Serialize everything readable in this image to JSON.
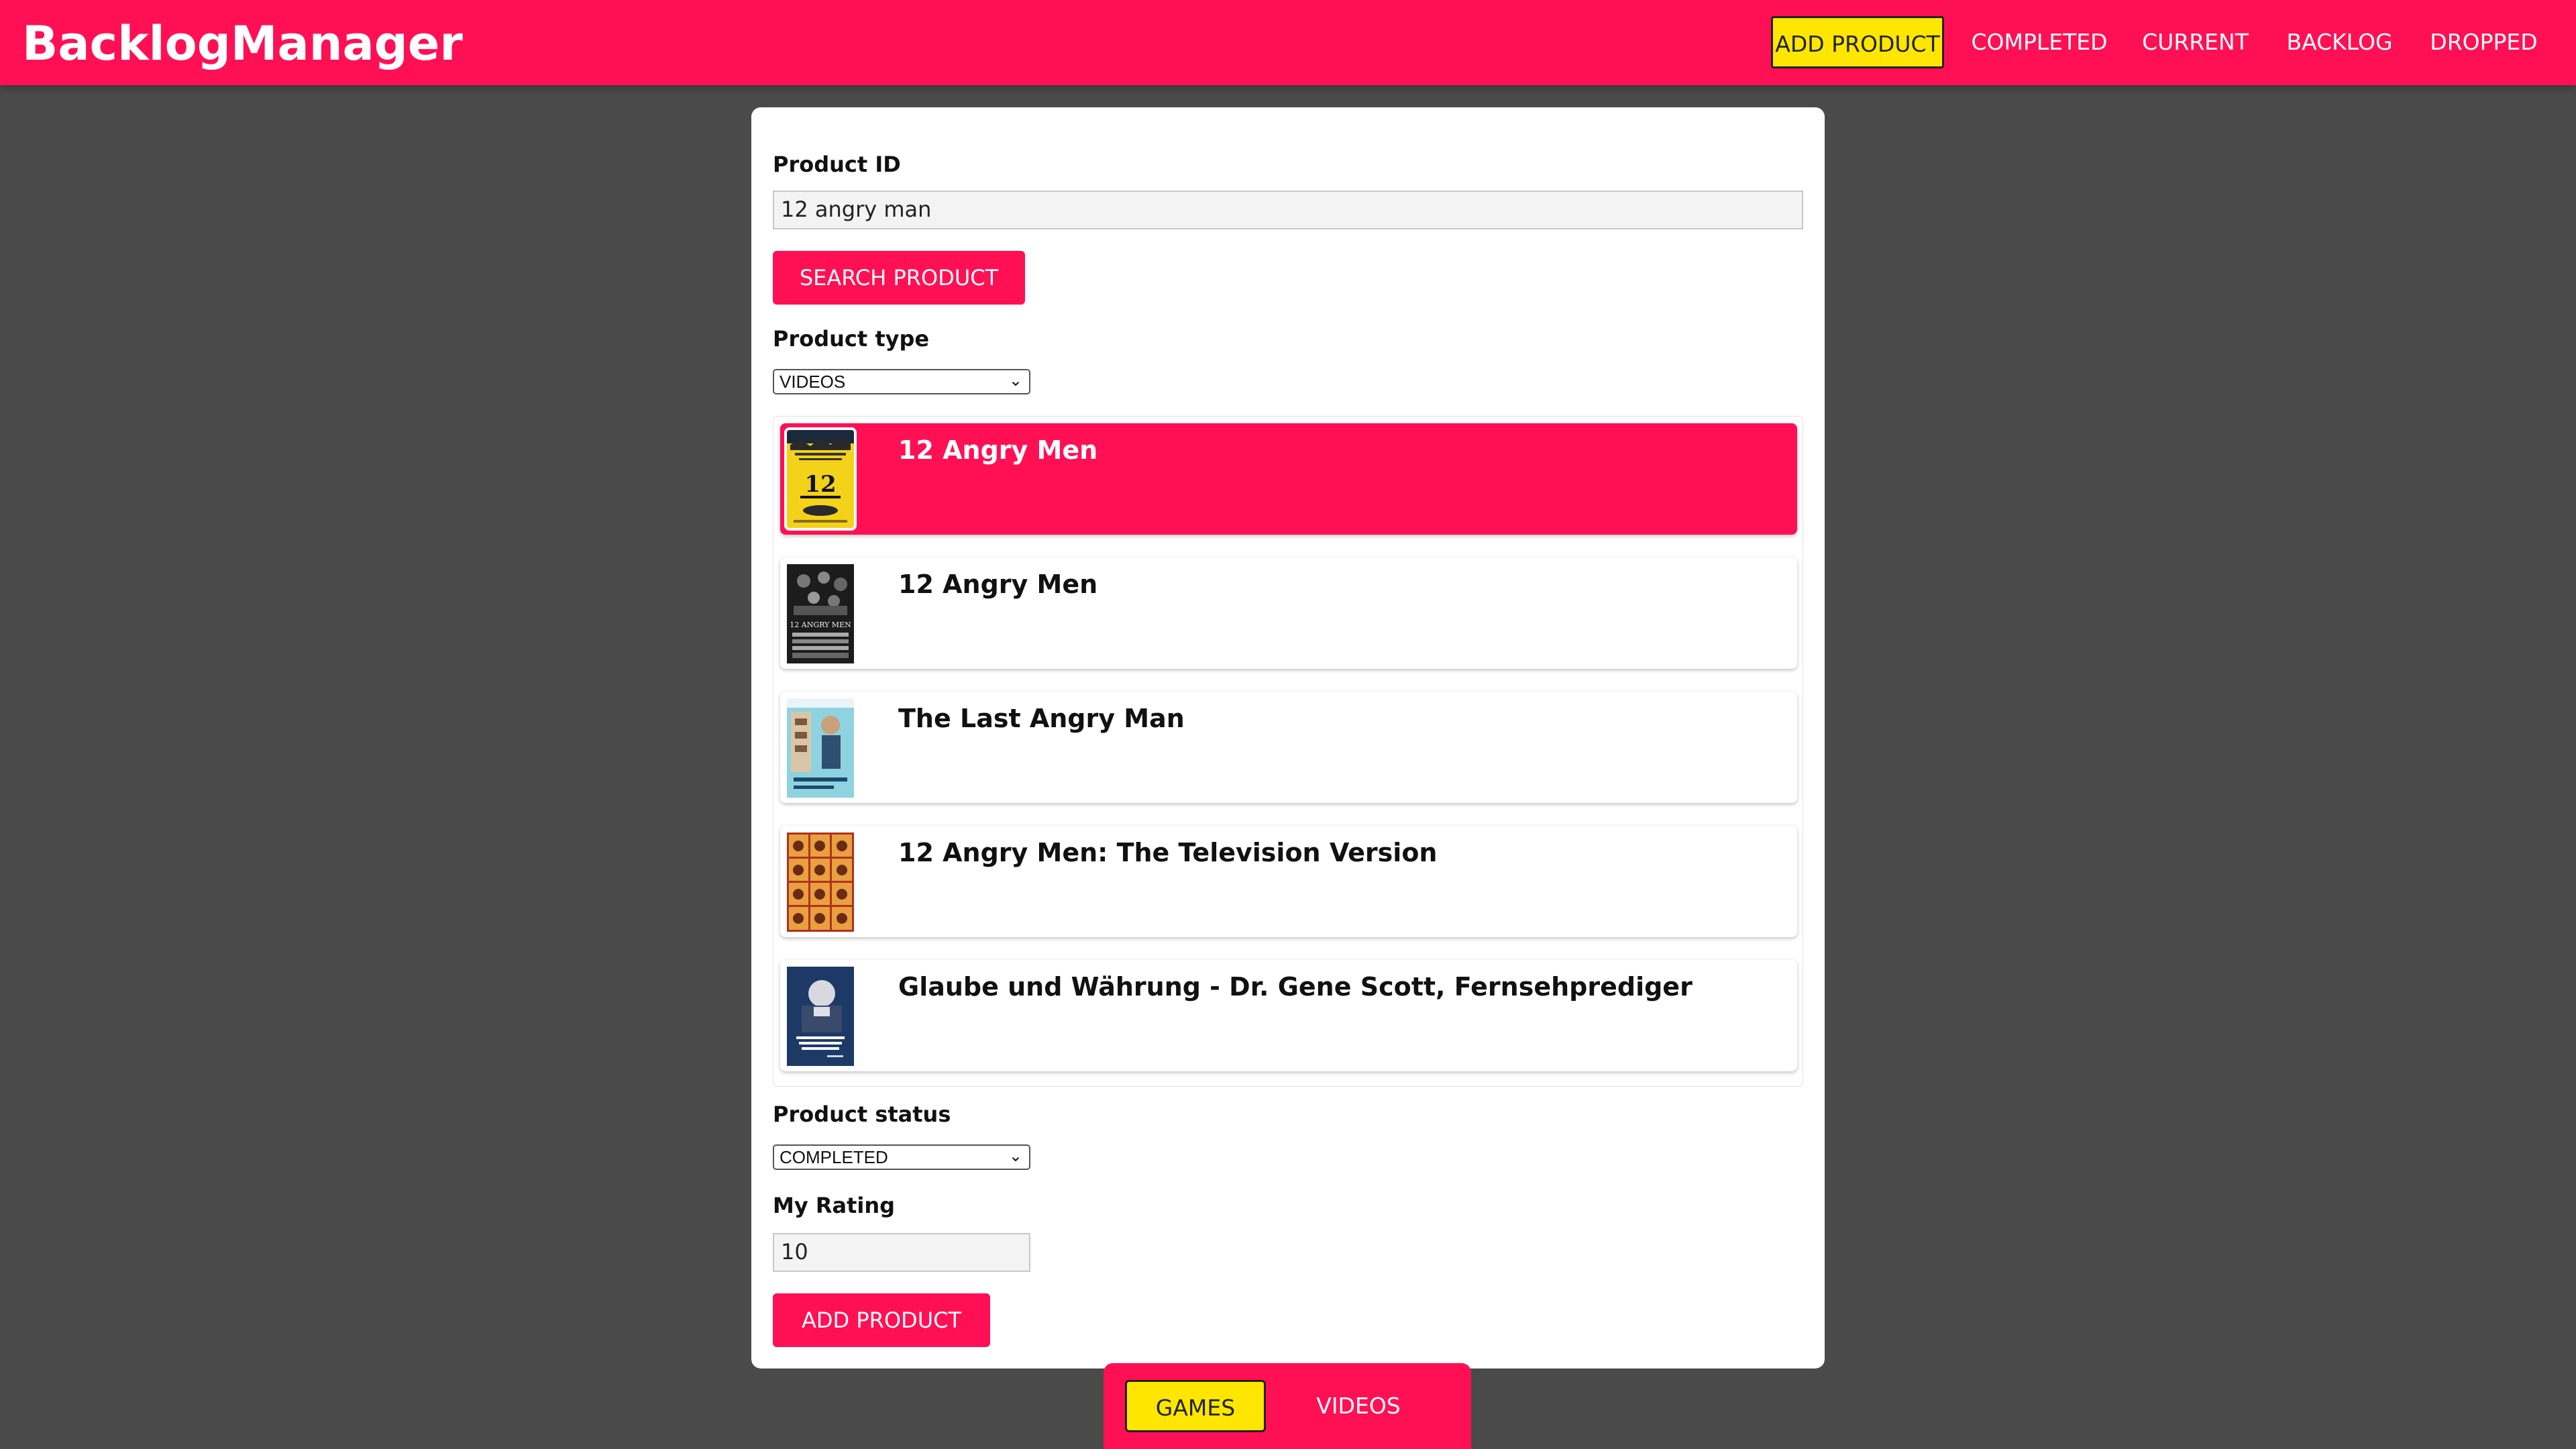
{
  "app": {
    "brand": "BacklogManager"
  },
  "nav": {
    "items": [
      {
        "label": "ADD PRODUCT",
        "active": true
      },
      {
        "label": "COMPLETED",
        "active": false
      },
      {
        "label": "CURRENT",
        "active": false
      },
      {
        "label": "BACKLOG",
        "active": false
      },
      {
        "label": "DROPPED",
        "active": false
      }
    ]
  },
  "form": {
    "product_id_label": "Product ID",
    "product_id_value": "12 angry man",
    "search_button": "SEARCH PRODUCT",
    "product_type_label": "Product type",
    "product_type_value": "VIDEOS",
    "product_status_label": "Product status",
    "product_status_value": "COMPLETED",
    "rating_label": "My Rating",
    "rating_value": "10",
    "add_button": "ADD PRODUCT"
  },
  "results": [
    {
      "title": "12 Angry Men",
      "selected": true,
      "poster": "yellow-poster"
    },
    {
      "title": "12 Angry Men",
      "selected": false,
      "poster": "dark-poster"
    },
    {
      "title": "The Last Angry Man",
      "selected": false,
      "poster": "blue-poster"
    },
    {
      "title": "12 Angry Men: The Television Version",
      "selected": false,
      "poster": "grid-poster"
    },
    {
      "title": "Glaube und Währung - Dr. Gene Scott, Fernsehprediger",
      "selected": false,
      "poster": "portrait-poster"
    }
  ],
  "footer": {
    "games": "GAMES",
    "videos": "VIDEOS",
    "active": "GAMES"
  },
  "colors": {
    "accent": "#ff1054",
    "highlight": "#ffe600",
    "background": "#4a4a4a"
  }
}
